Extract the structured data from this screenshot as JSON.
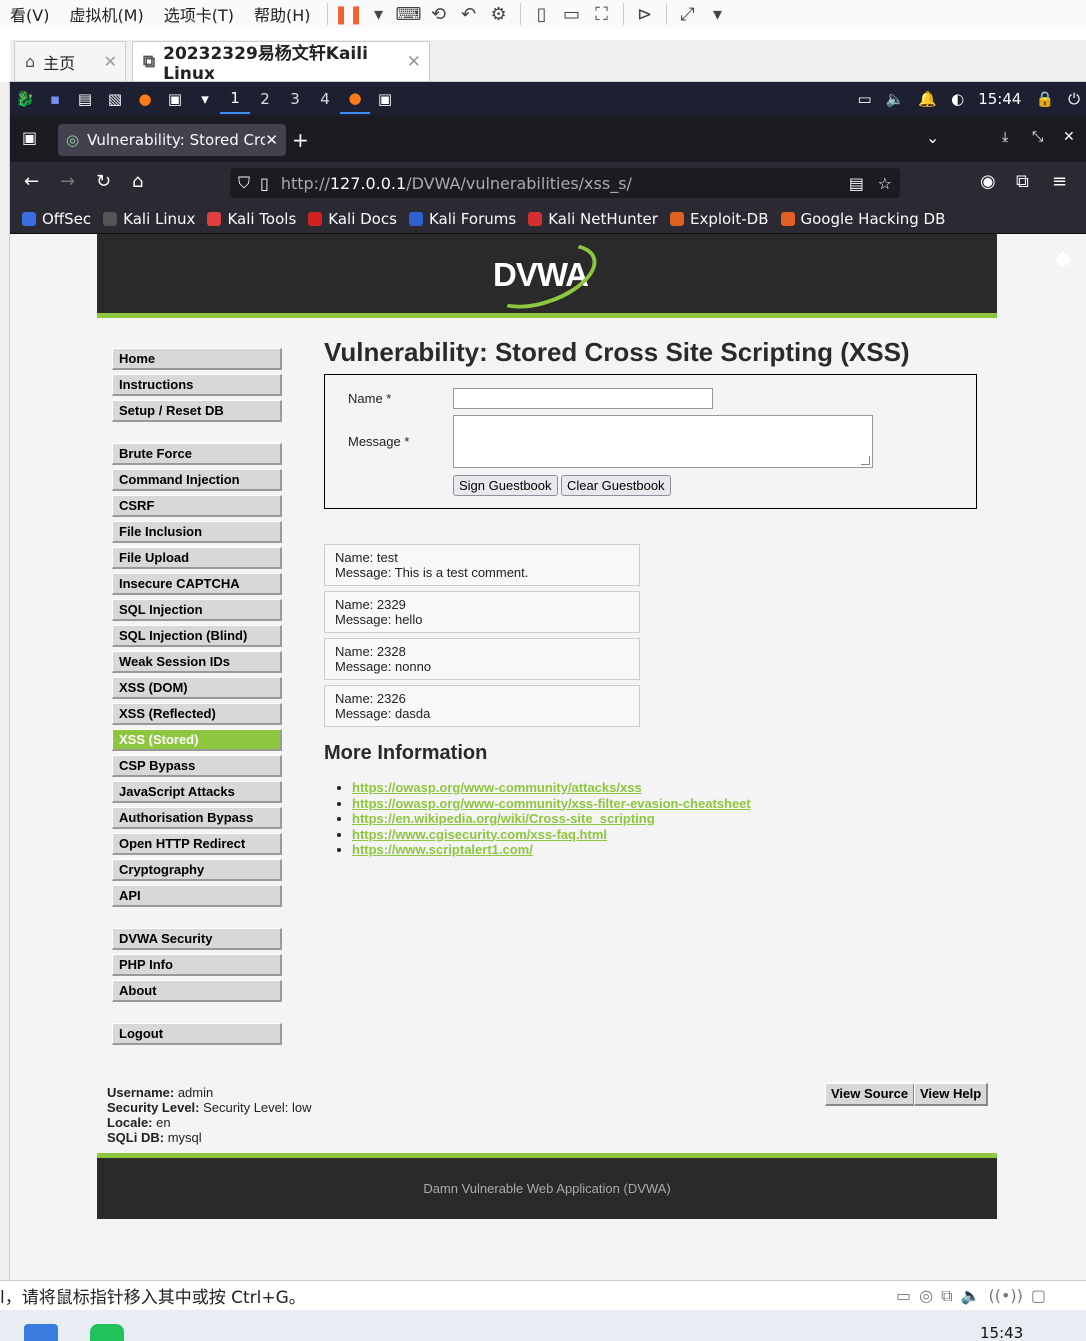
{
  "vm": {
    "menu": [
      "看(V)",
      "虚拟机(M)",
      "选项卡(T)",
      "帮助(H)"
    ],
    "tabs": [
      {
        "label": "主页"
      },
      {
        "label": "20232329易杨文轩Kaili Linux"
      }
    ],
    "status_text": "l，请将鼠标指针移入其中或按 Ctrl+G。"
  },
  "kali": {
    "workspaces": [
      "1",
      "2",
      "3",
      "4"
    ],
    "time": "15:44"
  },
  "firefox": {
    "tab_title": "Vulnerability: Stored Cros",
    "url_prefix": "http://",
    "url_host": "127.0.0.1",
    "url_path": "/DVWA/vulnerabilities/xss_s/",
    "bookmarks": [
      {
        "label": "OffSec",
        "color": "#3a6ee0"
      },
      {
        "label": "Kali Linux",
        "color": "#555555"
      },
      {
        "label": "Kali Tools",
        "color": "#e04040"
      },
      {
        "label": "Kali Docs",
        "color": "#d02020"
      },
      {
        "label": "Kali Forums",
        "color": "#3060d0"
      },
      {
        "label": "Kali NetHunter",
        "color": "#d03030"
      },
      {
        "label": "Exploit-DB",
        "color": "#e06020"
      },
      {
        "label": "Google Hacking DB",
        "color": "#e06020"
      }
    ]
  },
  "dvwa": {
    "logo": "DVWA",
    "title": "Vulnerability: Stored Cross Site Scripting (XSS)",
    "menu_group1": [
      "Home",
      "Instructions",
      "Setup / Reset DB"
    ],
    "menu_group2": [
      "Brute Force",
      "Command Injection",
      "CSRF",
      "File Inclusion",
      "File Upload",
      "Insecure CAPTCHA",
      "SQL Injection",
      "SQL Injection (Blind)",
      "Weak Session IDs",
      "XSS (DOM)",
      "XSS (Reflected)",
      "XSS (Stored)",
      "CSP Bypass",
      "JavaScript Attacks",
      "Authorisation Bypass",
      "Open HTTP Redirect",
      "Cryptography",
      "API"
    ],
    "menu_group3": [
      "DVWA Security",
      "PHP Info",
      "About"
    ],
    "menu_group4": [
      "Logout"
    ],
    "selected": "XSS (Stored)",
    "form": {
      "name_label": "Name *",
      "message_label": "Message *",
      "name_value": "",
      "message_value": "",
      "sign_button": "Sign Guestbook",
      "clear_button": "Clear Guestbook"
    },
    "entries": [
      {
        "name": "Name: test",
        "message": "Message: This is a test comment."
      },
      {
        "name": "Name: 2329",
        "message": "Message: hello"
      },
      {
        "name": "Name: 2328",
        "message": "Message: nonno"
      },
      {
        "name": "Name: 2326",
        "message": "Message: dasda"
      }
    ],
    "more_info_heading": "More Information",
    "links": [
      "https://owasp.org/www-community/attacks/xss",
      "https://owasp.org/www-community/xss-filter-evasion-cheatsheet",
      "https://en.wikipedia.org/wiki/Cross-site_scripting",
      "https://www.cgisecurity.com/xss-faq.html",
      "https://www.scriptalert1.com/"
    ],
    "status": {
      "username_label": "Username:",
      "username": "admin",
      "security_label": "Security Level:",
      "security": "Security Level: low",
      "locale_label": "Locale:",
      "locale": "en",
      "sqli_label": "SQLi DB:",
      "sqli": "mysql"
    },
    "view_source": "View Source",
    "view_help": "View Help",
    "footer": "Damn Vulnerable Web Application (DVWA)"
  },
  "windows": {
    "clock": "15:43"
  }
}
